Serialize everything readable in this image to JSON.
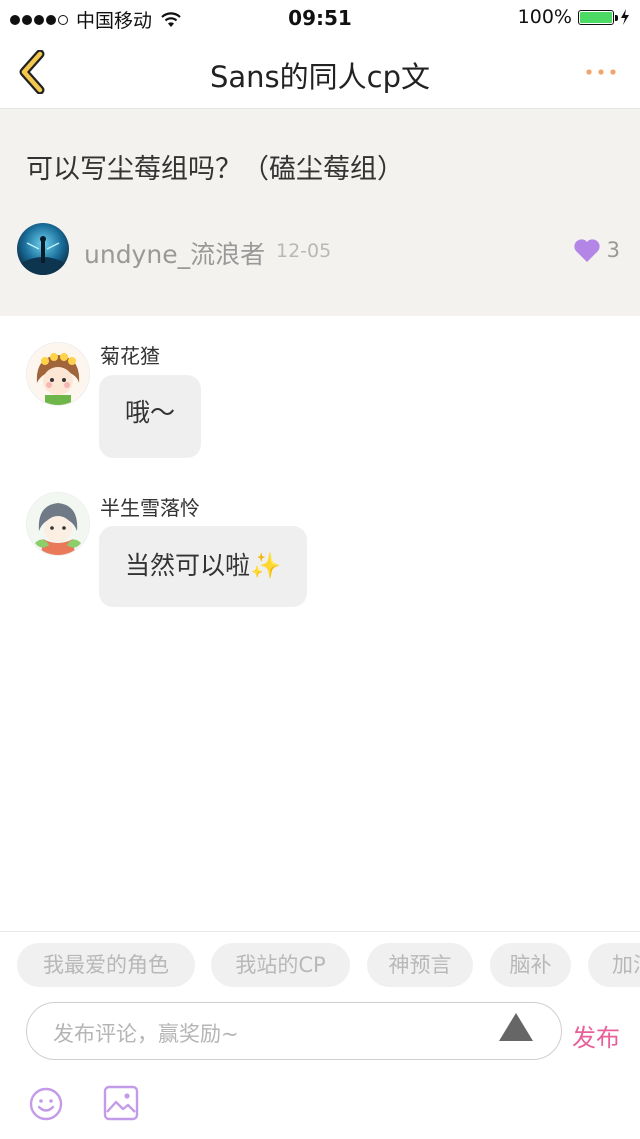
{
  "status_bar": {
    "carrier": "中国移动",
    "time": "09:51",
    "battery": "100%",
    "battery_level": 1.0
  },
  "nav": {
    "title": "Sans的同人cp文",
    "back_icon": "chevron-left-icon",
    "more_icon": "more-dots-icon",
    "accent_color": "#f2c94c",
    "more_color": "#f5a36b"
  },
  "post": {
    "title": "可以写尘莓组吗？（磕尘莓组）",
    "author": "undyne_流浪者",
    "date": "12-05",
    "likes": "3",
    "like_color": "#b385e6"
  },
  "comments": [
    {
      "user": "菊花猹",
      "text": "哦～"
    },
    {
      "user": "半生雪落怜",
      "text": "当然可以啦✨"
    }
  ],
  "tags": [
    "我最爱的角色",
    "我站的CP",
    "神预言",
    "脑补",
    "加油"
  ],
  "composer": {
    "placeholder": "发布评论，赢奖励~",
    "publish_label": "发布",
    "publish_color": "#e8609a",
    "emoji_icon": "smiley-icon",
    "image_icon": "image-icon",
    "icon_color": "#c39be8"
  }
}
